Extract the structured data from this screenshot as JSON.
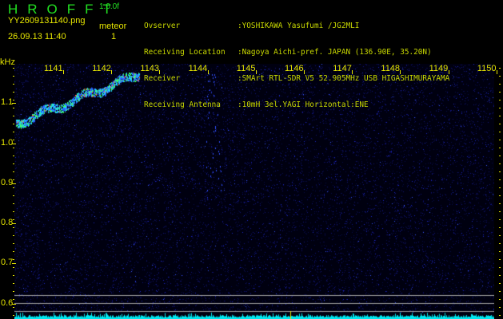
{
  "header": {
    "app_name": "HROFFT",
    "version": "1.0.0f",
    "filename": "YY2609131140.png",
    "datetime": "26.09.13 11:40",
    "mode": "meteor",
    "count": "1"
  },
  "info": [
    {
      "key": "Ovserver",
      "value": ":YOSHIKAWA Yasufumi /JG2MLI"
    },
    {
      "key": "Receiving Location",
      "value": ":Nagoya Aichi-pref. JAPAN (136.90E, 35.20N)"
    },
    {
      "key": "Receiver",
      "value": ":SMArt RTL-SDR V5 52.905MHz USB HIGASHIMURAYAMA"
    },
    {
      "key": "Receiving Antenna",
      "value": ":10mH 3el.YAGI Horizontal:ENE"
    }
  ],
  "axis": {
    "y_unit": "kHz",
    "y_labels": [
      "1.1",
      "1.0",
      "0.9",
      "0.8",
      "0.7",
      "0.6"
    ],
    "time_labels": [
      "1141",
      "1142",
      "1143",
      "1144",
      "1145",
      "1146",
      "1147",
      "1148",
      "1149",
      "1150"
    ]
  },
  "colors": {
    "text_yellow": "#e6e600",
    "logo_green": "#22e022",
    "noise_blue": "#1a1ab0",
    "spectrum_cyan": "#00e8f0"
  }
}
